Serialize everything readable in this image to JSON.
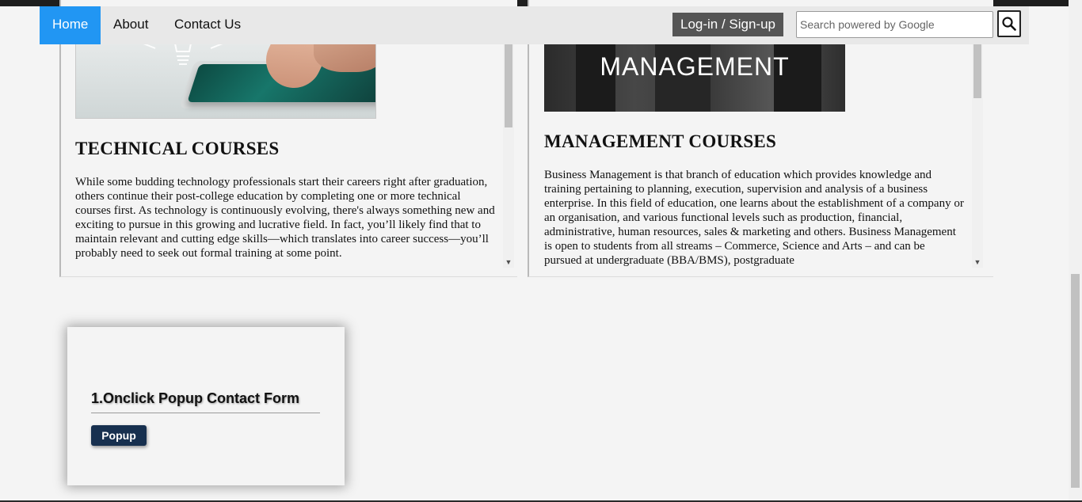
{
  "nav": {
    "links": [
      {
        "label": "Home",
        "active": true
      },
      {
        "label": "About",
        "active": false
      },
      {
        "label": "Contact Us",
        "active": false
      }
    ],
    "login_label": "Log-in / Sign-up",
    "search_placeholder": "Search powered by Google",
    "search_icon": "search-icon",
    "active_color": "#2196f3"
  },
  "courses": {
    "technical": {
      "title": "TECHNICAL COURSES",
      "text": "While some budding technology professionals start their careers right after graduation, others continue their post-college education by completing one or more technical courses first. As technology is continuously evolving, there's always something new and exciting to pursue in this growing and lucrative field. In fact, you’ll likely find that to maintain relevant and cutting edge skills—which translates into career success—you’ll probably need to seek out formal training at some point."
    },
    "management": {
      "image_caption": "MANAGEMENT",
      "title": "MANAGEMENT COURSES",
      "text": "Business Management is that branch of education which provides knowledge and training pertaining to planning, execution, supervision and analysis of a business enterprise. In this field of education, one learns about the establishment of a company or an organisation, and various functional levels such as production, financial, administrative, human resources, sales & marketing and others. Business Management is open to students from all streams – Commerce, Science and Arts – and can be pursued at undergraduate (BBA/BMS), postgraduate"
    }
  },
  "popup_section": {
    "title": "1.Onclick Popup Contact Form",
    "button_label": "Popup",
    "button_color": "#17304f"
  }
}
